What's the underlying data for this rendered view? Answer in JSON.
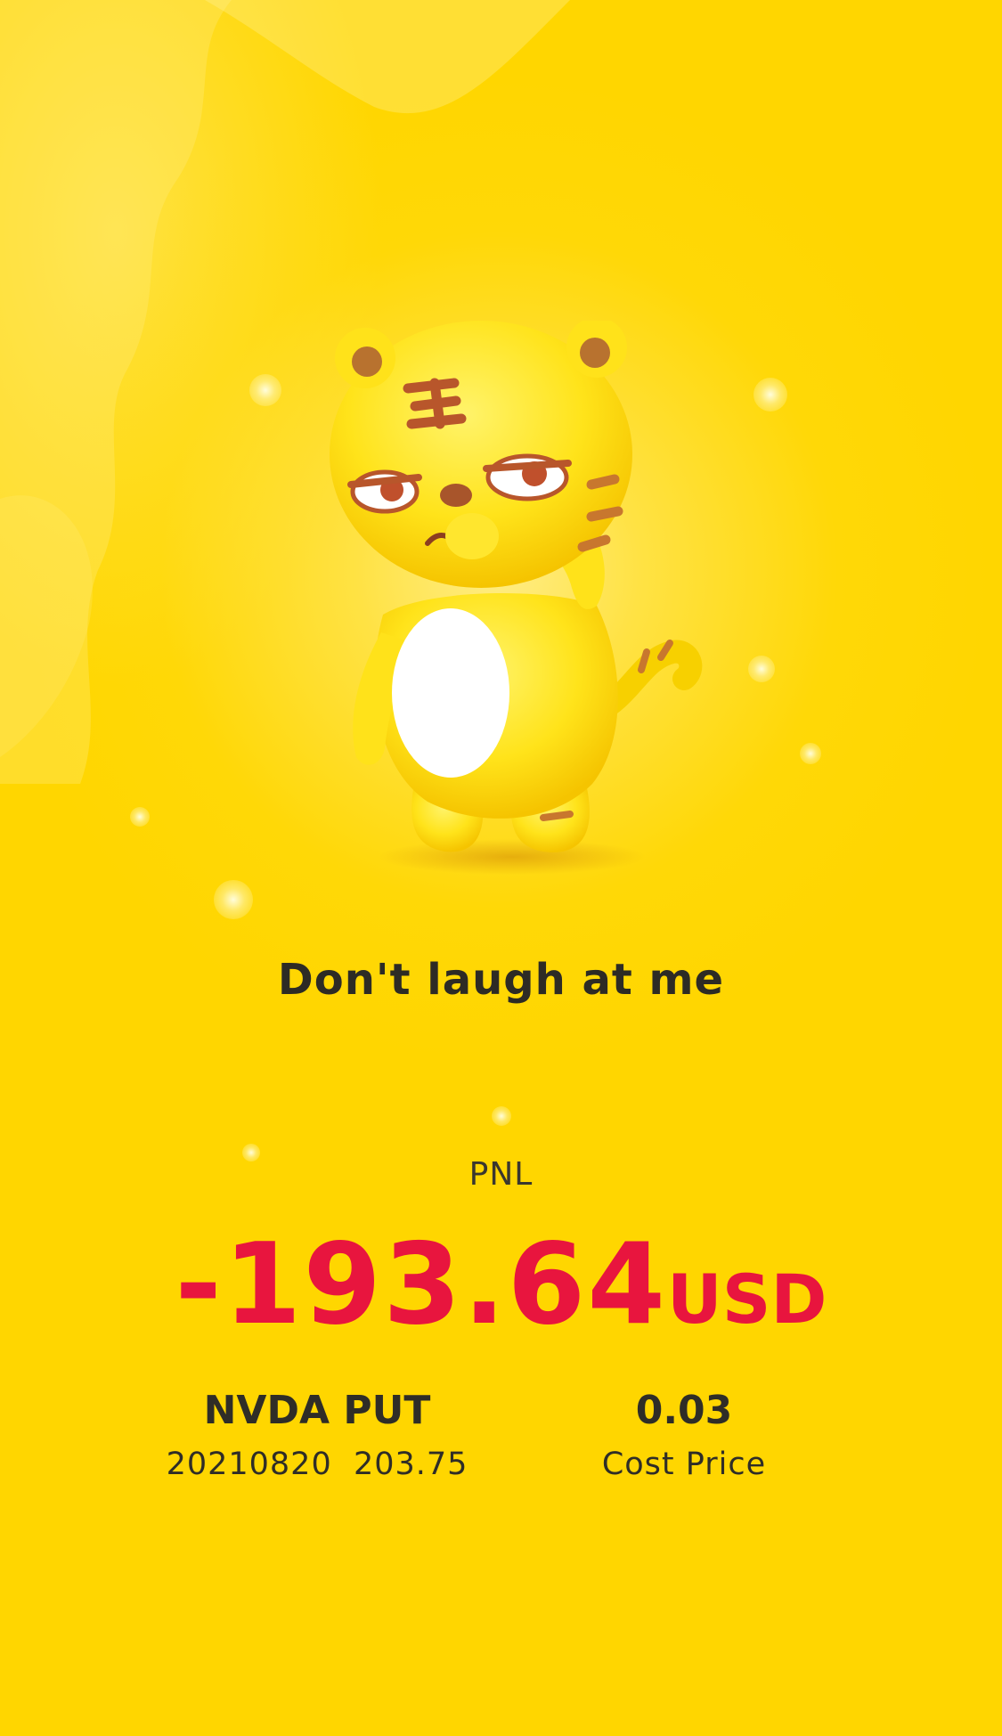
{
  "card": {
    "tagline": "Don't laugh at me",
    "pnl_label": "PNL",
    "pnl_value": "-193.64",
    "pnl_currency": "USD",
    "contract": {
      "name": "NVDA PUT",
      "detail": "20210820  203.75"
    },
    "cost": {
      "value": "0.03",
      "label": "Cost Price"
    }
  },
  "colors": {
    "background": "#FFD600",
    "loss": "#E8153E",
    "text": "#2D2B25"
  },
  "icons": {
    "mascot": "tiger-mascot-icon"
  }
}
